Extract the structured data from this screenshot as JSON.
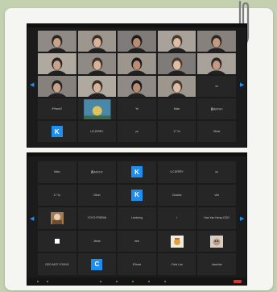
{
  "colors": {
    "accent": "#1d8ff2",
    "tile": "#262626",
    "end": "#d9342b"
  },
  "panel1": {
    "tiles": [
      {
        "type": "video"
      },
      {
        "type": "video"
      },
      {
        "type": "video"
      },
      {
        "type": "video"
      },
      {
        "type": "video"
      },
      {
        "type": "video"
      },
      {
        "type": "video"
      },
      {
        "type": "video"
      },
      {
        "type": "video"
      },
      {
        "type": "video"
      },
      {
        "type": "video"
      },
      {
        "type": "video"
      },
      {
        "type": "video"
      },
      {
        "type": "video"
      },
      {
        "type": "name",
        "label": "ve"
      },
      {
        "type": "name",
        "label": "iPhone2"
      },
      {
        "type": "image"
      },
      {
        "type": "name",
        "label": "Ye"
      },
      {
        "type": "name",
        "label": "Miao"
      },
      {
        "type": "name",
        "label": "鹏ANTHY"
      },
      {
        "type": "avatar",
        "label": "K"
      },
      {
        "type": "name",
        "label": "LICJERRY"
      },
      {
        "type": "name",
        "label": "yu"
      },
      {
        "type": "name",
        "label": "17 Yu"
      },
      {
        "type": "name",
        "label": "Oliver"
      }
    ]
  },
  "panel2": {
    "tiles": [
      {
        "type": "name",
        "label": "Miao"
      },
      {
        "type": "name",
        "label": "鹏ANTHY"
      },
      {
        "type": "avatar",
        "label": "K"
      },
      {
        "type": "name",
        "label": "LICJERRY"
      },
      {
        "type": "name",
        "label": "yu"
      },
      {
        "type": "name",
        "label": "17 Yu"
      },
      {
        "type": "name",
        "label": "Oliver"
      },
      {
        "type": "avatar",
        "label": "K"
      },
      {
        "type": "name",
        "label": "Charles"
      },
      {
        "type": "name",
        "label": "Vini"
      },
      {
        "type": "image"
      },
      {
        "type": "name",
        "label": "YOYO FREEMI"
      },
      {
        "type": "name",
        "label": "Lionheng"
      },
      {
        "type": "name",
        "label": "i"
      },
      {
        "type": "name",
        "label": "Han Yan Henry DOG"
      },
      {
        "type": "white"
      },
      {
        "type": "name",
        "label": "Jesse"
      },
      {
        "type": "name",
        "label": "Iree"
      },
      {
        "type": "image2"
      },
      {
        "type": "image3"
      },
      {
        "type": "name",
        "label": "GEO ANTI YOUNG"
      },
      {
        "type": "avatar",
        "label": "C"
      },
      {
        "type": "name",
        "label": "iPhone"
      },
      {
        "type": "name",
        "label": "Chris Lan"
      },
      {
        "type": "name",
        "label": "Jasmine"
      }
    ]
  }
}
